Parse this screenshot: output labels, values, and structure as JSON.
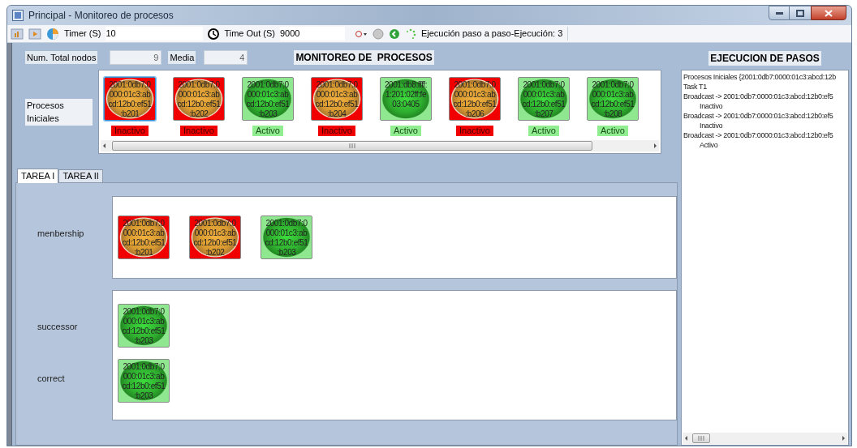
{
  "window": {
    "title": "Principal - Monitoreo de procesos"
  },
  "toolbar": {
    "timer_label": "Timer (S)",
    "timer_value": "10",
    "timeout_label": "Time Out (S)",
    "timeout_value": "9000",
    "status": "Ejecución paso a paso-Ejecución: 3"
  },
  "summary": {
    "total_label": "Num. Total nodos",
    "total_value": "9",
    "media_label": "Media",
    "media_value": "4",
    "title": "MONITOREO DE  PROCESOS"
  },
  "initial": {
    "label": "Procesos Iniciales",
    "nodes": [
      {
        "address": [
          "2001:0db7:0",
          "000:01c3:ab",
          "cd:12b0:ef51",
          ":b201"
        ],
        "active": false,
        "status": "Inactivo",
        "selected": true
      },
      {
        "address": [
          "2001:0db7:0",
          "000:01c3:ab",
          "cd:12b0:ef51",
          ":b202"
        ],
        "active": false,
        "status": "Inactivo",
        "selected": false
      },
      {
        "address": [
          "2001:0db7:0",
          "000:01c3:ab",
          "cd:12b0:ef51",
          ":b203"
        ],
        "active": true,
        "status": "Activo",
        "selected": false
      },
      {
        "address": [
          "2001:0db7:0",
          "000:01c3:ab",
          "cd:12b0:ef51",
          ":b204"
        ],
        "active": false,
        "status": "Inactivo",
        "selected": false
      },
      {
        "address": [
          "2001:db8:ffff:",
          "1:201:02ff:fe",
          "03:0405"
        ],
        "active": true,
        "status": "Activo",
        "selected": false
      },
      {
        "address": [
          "2001:0db7:0",
          "000:01c3:ab",
          "cd:12b0:ef51",
          ":b206"
        ],
        "active": false,
        "status": "Inactivo",
        "selected": false
      },
      {
        "address": [
          "2001:0db7:0",
          "000:01c3:ab",
          "cd:12b0:ef51",
          ":b207"
        ],
        "active": true,
        "status": "Activo",
        "selected": false
      },
      {
        "address": [
          "2001:0db7:0",
          "000:01c3:ab",
          "cd:12b0:ef51",
          ":b208"
        ],
        "active": true,
        "status": "Activo",
        "selected": false
      }
    ]
  },
  "tabs": [
    {
      "label": "TAREA I",
      "selected": true
    },
    {
      "label": "TAREA II",
      "selected": false
    }
  ],
  "groups": [
    {
      "rows": [
        {
          "label": "menbership",
          "nodes": [
            {
              "address": [
                "2001:0db7:0",
                "000:01c3:ab",
                "cd:12b0:ef51",
                ":b201"
              ],
              "active": false
            },
            {
              "address": [
                "2001:0db7:0",
                "000:01c3:ab",
                "cd:12b0:ef51",
                ":b202"
              ],
              "active": false
            },
            {
              "address": [
                "2001:0db7:0",
                "000:01c3:ab",
                "cd:12b0:ef51",
                ":b203"
              ],
              "active": true
            }
          ]
        }
      ]
    },
    {
      "rows": [
        {
          "label": "successor",
          "nodes": [
            {
              "address": [
                "2001:0db7:0",
                "000:01c3:ab",
                "cd:12b0:ef51",
                ":b203"
              ],
              "active": true
            }
          ]
        },
        {
          "label": "correct",
          "nodes": [
            {
              "address": [
                "2001:0db7:0",
                "000:01c3:ab",
                "cd:12b0:ef51",
                ":b203"
              ],
              "active": true
            }
          ]
        }
      ]
    }
  ],
  "log": {
    "title": "EJECUCION DE PASOS",
    "lines": [
      {
        "text": "Procesos Iniciales {2001:0db7:0000:01c3:abcd:12b",
        "indented": false
      },
      {
        "text": "Task T1",
        "indented": false
      },
      {
        "text": "Broadcast -> 2001:0db7:0000:01c3:abcd:12b0:ef5",
        "indented": false
      },
      {
        "text": "Inactivo",
        "indented": true
      },
      {
        "text": "Broadcast -> 2001:0db7:0000:01c3:abcd:12b0:ef5",
        "indented": false
      },
      {
        "text": "Inactivo",
        "indented": true
      },
      {
        "text": "Broadcast -> 2001:0db7:0000:01c3:abcd:12b0:ef5",
        "indented": false
      },
      {
        "text": "Activo",
        "indented": true
      }
    ]
  }
}
